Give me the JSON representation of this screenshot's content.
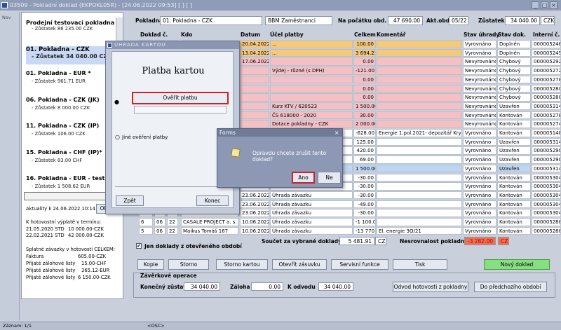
{
  "window": {
    "title": "03509 - Pokladní doklad (EKPOKL05R) - [24.06.2022 09:53] [ ] [ ]"
  },
  "nav": {
    "label": "Nav"
  },
  "sidebar": {
    "accounts": [
      {
        "name": "Prodejní testovací pokladna",
        "balance": "- Zůstatek 86 235.00 CZK"
      },
      {
        "name": "01. Pokladna - CZK",
        "balance": "- Zůstatek 34 040.00 CZK"
      },
      {
        "name": "01. Pokladna - EUR *",
        "balance": "- Zůstatek 961.71 EUR"
      },
      {
        "name": "06. Pokladna - CZK (JK)",
        "balance": "- Zůstatek 8 000.00 CZK"
      },
      {
        "name": "11. Pokladna - CZK (IP)",
        "balance": "- Zůstatek 106.00 CZK"
      },
      {
        "name": "15. Pokladna - CHF (IP)*",
        "balance": "- Zůstatek 83.00 CHF"
      },
      {
        "name": "16. Pokladna - EUR - test",
        "balance": "- Zůstatek 1 508.62 EUR"
      }
    ],
    "actuality": "Aktuality k 24.06.2022 10:14",
    "actuality_button": "Ob",
    "payout_title": "K hotovostní výplatě v termínu:",
    "payouts": [
      [
        "21.05.2020 STD",
        "10 000.00-CZK"
      ],
      [
        "22.02.2021 STD",
        "42 000.00-CZK"
      ]
    ],
    "liabilities_title": "Splatné závazky v hotovosti CELKEM:",
    "liabilities": [
      [
        "Faktura",
        "605.00-CZK"
      ],
      [
        "Přijaté zálohové listy",
        "15.00-CHF"
      ],
      [
        "Přijaté zálohové listy",
        "365.12-EUR"
      ],
      [
        "Přijaté zálohové listy",
        "6 150.00-CZK"
      ]
    ]
  },
  "header": {
    "pokladna_label": "Pokladna",
    "pokladna_value": "01. Pokladna - CZK",
    "user_value": "BBM Zaměstnanci",
    "start_label": "Na počátku obd.",
    "start_value": "47 690.00",
    "period_label": "Akt.obd.",
    "period_value": "05/22",
    "balance_label": "Zůstatek",
    "balance_value": "34 040.00",
    "currency": "CZK"
  },
  "grid": {
    "columns": [
      "Doklad č.",
      "Kdo",
      "Datum",
      "Účel platby",
      "Celkem",
      "Komentář",
      "Stav úhrady",
      "Stav dok.",
      "Interní č."
    ],
    "rows": [
      {
        "kdo": "",
        "datum": "20.04.2022",
        "ucel": "...",
        "celkem": "100.00",
        "koment": "",
        "uhrada": "Vyrovnáno",
        "dok": "Doplněn",
        "interni": "0000052463",
        "color": "orange"
      },
      {
        "kdo": "",
        "datum": "13.04.2022",
        "ucel": "...",
        "celkem": "3 694.21",
        "koment": "",
        "uhrada": "Vyrovnáno",
        "dok": "Doplněn",
        "interni": "0000052453",
        "color": "orange"
      },
      {
        "kdo": "",
        "datum": "17.06.2022",
        "ucel": "",
        "celkem": "0.00",
        "koment": "",
        "uhrada": "Nevyrovnáno",
        "dok": "Chybový",
        "interni": "0000052927",
        "color": "pink"
      },
      {
        "kdo": "",
        "datum": "",
        "ucel": "Výdej - různé (s DPH)",
        "celkem": "-121.00",
        "koment": "",
        "uhrada": "Nevyrovnáno",
        "dok": "Chybový",
        "interni": "0000052721",
        "color": "pink"
      },
      {
        "kdo": "",
        "datum": "",
        "ucel": "",
        "celkem": "0.00",
        "koment": "",
        "uhrada": "Nevyrovnáno",
        "dok": "Chybový",
        "interni": "0000052786",
        "color": "pink"
      },
      {
        "kdo": "",
        "datum": "",
        "ucel": "",
        "celkem": "0.00",
        "koment": "",
        "uhrada": "Nevyrovnáno",
        "dok": "Chybový",
        "interni": "0000052803",
        "color": "pink"
      },
      {
        "kdo": "",
        "datum": "",
        "ucel": "",
        "celkem": "0.00",
        "koment": "",
        "uhrada": "Nevyrovnáno",
        "dok": "Chybový",
        "interni": "0000052804",
        "color": "pink"
      },
      {
        "kdo": "",
        "datum": "",
        "ucel": "Kurz KTV / 620523",
        "celkem": "1 500.00",
        "koment": "",
        "uhrada": "Nevyrovnáno",
        "dok": "Uzavřen",
        "interni": "0000053141",
        "color": "pink"
      },
      {
        "kdo": "",
        "datum": "",
        "ucel": "ČS 618000 - 2020",
        "celkem": "30.00",
        "koment": "",
        "uhrada": "Nevyrovnáno",
        "dok": "Kontován",
        "interni": "0000052787",
        "color": "pink"
      },
      {
        "kdo": "",
        "datum": "",
        "ucel": "Dotace pokladny - CZK",
        "celkem": "2 000.00",
        "koment": "",
        "uhrada": "Nevyrovnáno",
        "dok": "Kontován",
        "interni": "0000052746",
        "color": "pink"
      },
      {
        "kdo": "",
        "datum": "",
        "ucel": "",
        "celkem": "-628.00",
        "koment": "Energie 1.pol.2021- depozitář Krystal -",
        "uhrada": "Vyrovnáno",
        "dok": "Kontován",
        "interni": "0000051481",
        "color": ""
      },
      {
        "kdo": "",
        "datum": "",
        "ucel": "",
        "celkem": "125.00",
        "koment": "",
        "uhrada": "Vyrovnáno",
        "dok": "Uzavřen",
        "interni": "0000053145",
        "color": ""
      },
      {
        "kdo": "",
        "datum": "",
        "ucel": "",
        "celkem": "420.00",
        "koment": "",
        "uhrada": "Vyrovnáno",
        "dok": "Uzavřen",
        "interni": "0000052905",
        "color": ""
      },
      {
        "kdo": "",
        "datum": "",
        "ucel": "",
        "celkem": "69.00",
        "koment": "",
        "uhrada": "Vyrovnáno",
        "dok": "Uzavřen",
        "interni": "0000052906",
        "color": ""
      },
      {
        "kdo": "",
        "datum": "",
        "ucel": "",
        "celkem": "1 500.00",
        "koment": "",
        "uhrada": "Vyrovnáno",
        "dok": "Uzavřen",
        "interni": "0000053143",
        "color": "blue"
      },
      {
        "kdo": "",
        "datum": "",
        "ucel": "Úhrada závazku",
        "celkem": "-30.00",
        "koment": "",
        "uhrada": "Vyrovnáno",
        "dok": "Kontován",
        "interni": "0000053044",
        "color": ""
      },
      {
        "kdo": "",
        "datum": "",
        "ucel": "Úhrada závazku",
        "celkem": "-30.00",
        "koment": "",
        "uhrada": "Vyrovnáno",
        "dok": "Kontován",
        "interni": "0000053045",
        "color": ""
      },
      {
        "kdo": "",
        "datum": "23.06.2022",
        "ucel": "Úhrada závazku",
        "celkem": "-30.00",
        "koment": "",
        "uhrada": "Vyrovnáno",
        "dok": "Kontován",
        "interni": "0000053043",
        "color": ""
      },
      {
        "kdo": "",
        "datum": "23.06.2022",
        "ucel": "Úhrada závazku",
        "celkem": "-49.00",
        "koment": "",
        "uhrada": "Vyrovnáno",
        "dok": "Kontován",
        "interni": "0000053046",
        "color": ""
      },
      {
        "kdo": "Maikus Tomáš 167",
        "datum": "23.06.2022",
        "ucel": "Úhrada závazku",
        "celkem": "-30.00",
        "koment": "",
        "uhrada": "Vyrovnáno",
        "dok": "Kontován",
        "interni": "0000053042",
        "color": ""
      },
      {
        "kdo": "CASALE PROJECT a. s. r",
        "datum": "10.06.2022",
        "ucel": "Úhrada závazku",
        "celkem": "-1 100.00",
        "koment": "",
        "uhrada": "Vyrovnáno",
        "dok": "Kontován",
        "interni": "0000052884",
        "color": ""
      },
      {
        "kdo": "Maikus Tomáš 167",
        "datum": "10.06.2022",
        "ucel": "Úhrada závazku",
        "celkem": "-13 770.00",
        "koment": "El. energie 3Q/21",
        "uhrada": "Vyrovnáno",
        "dok": "Kontován",
        "interni": "0000052883",
        "color": ""
      }
    ],
    "row_prefix": [
      [
        "",
        "",
        ""
      ],
      [
        "",
        "",
        ""
      ],
      [
        "",
        "",
        ""
      ],
      [
        "",
        "",
        ""
      ],
      [
        "",
        "",
        ""
      ],
      [
        "",
        "",
        ""
      ],
      [
        "",
        "",
        ""
      ],
      [
        "",
        "",
        ""
      ],
      [
        "",
        "",
        ""
      ],
      [
        "",
        "",
        ""
      ],
      [
        "",
        "",
        ""
      ],
      [
        "",
        "",
        ""
      ],
      [
        "",
        "",
        ""
      ],
      [
        "",
        "",
        ""
      ],
      [
        "",
        "",
        ""
      ],
      [
        "",
        "",
        ""
      ],
      [
        "",
        "",
        ""
      ],
      [
        "",
        "",
        ""
      ],
      [
        "",
        "",
        ""
      ],
      [
        "",
        "",
        ""
      ],
      [
        "6",
        "06",
        "22"
      ],
      [
        "5",
        "06",
        "22"
      ]
    ]
  },
  "footer": {
    "only_open_label": "Jen doklady z otevřeného období",
    "sum_label": "Součet za vybrané doklady",
    "sum_value": "5 481.91",
    "sum_currency": "CZK",
    "mismatch_label": "Nesrovnalost pokladny",
    "mismatch_value": "-3 282.00",
    "mismatch_currency": "CZK",
    "buttons": [
      "Kopie",
      "Storno",
      "Storno kartou",
      "Otevřít zásuvku",
      "Servisní funkce",
      "Tisk"
    ],
    "new_button": "Nový doklad",
    "closing_title": "Závěrkové operace",
    "final_balance_label": "Konečný zůstatek",
    "final_balance_value": "34 040.00",
    "deposit_label": "Záloha",
    "deposit_value": "0.00",
    "payout_label": "K odvodu",
    "payout_value": "34 040.00",
    "handover_button": "Odvod hotovosti z pokladny",
    "prev_period_button": "Do předchozího období"
  },
  "dialog_card": {
    "title": "ÚHRADA KARTOU",
    "heading": "Platba kartou",
    "verify_button": "Ověřit platbu",
    "other_label": "Jiné ověření platby",
    "back_button": "Zpět",
    "end_button": "Konec"
  },
  "dialog_confirm": {
    "title": "Forms",
    "message": "Opravdu chcete zrušit tento doklad?",
    "yes_button": "Ano",
    "no_button": "Ne"
  },
  "statusbar": {
    "record": "Záznam: 1/1",
    "mode": "<OSC>"
  },
  "colors": {
    "accent_red": "#d0202a",
    "green_button": "#86e080",
    "mismatch": "#f07050"
  }
}
